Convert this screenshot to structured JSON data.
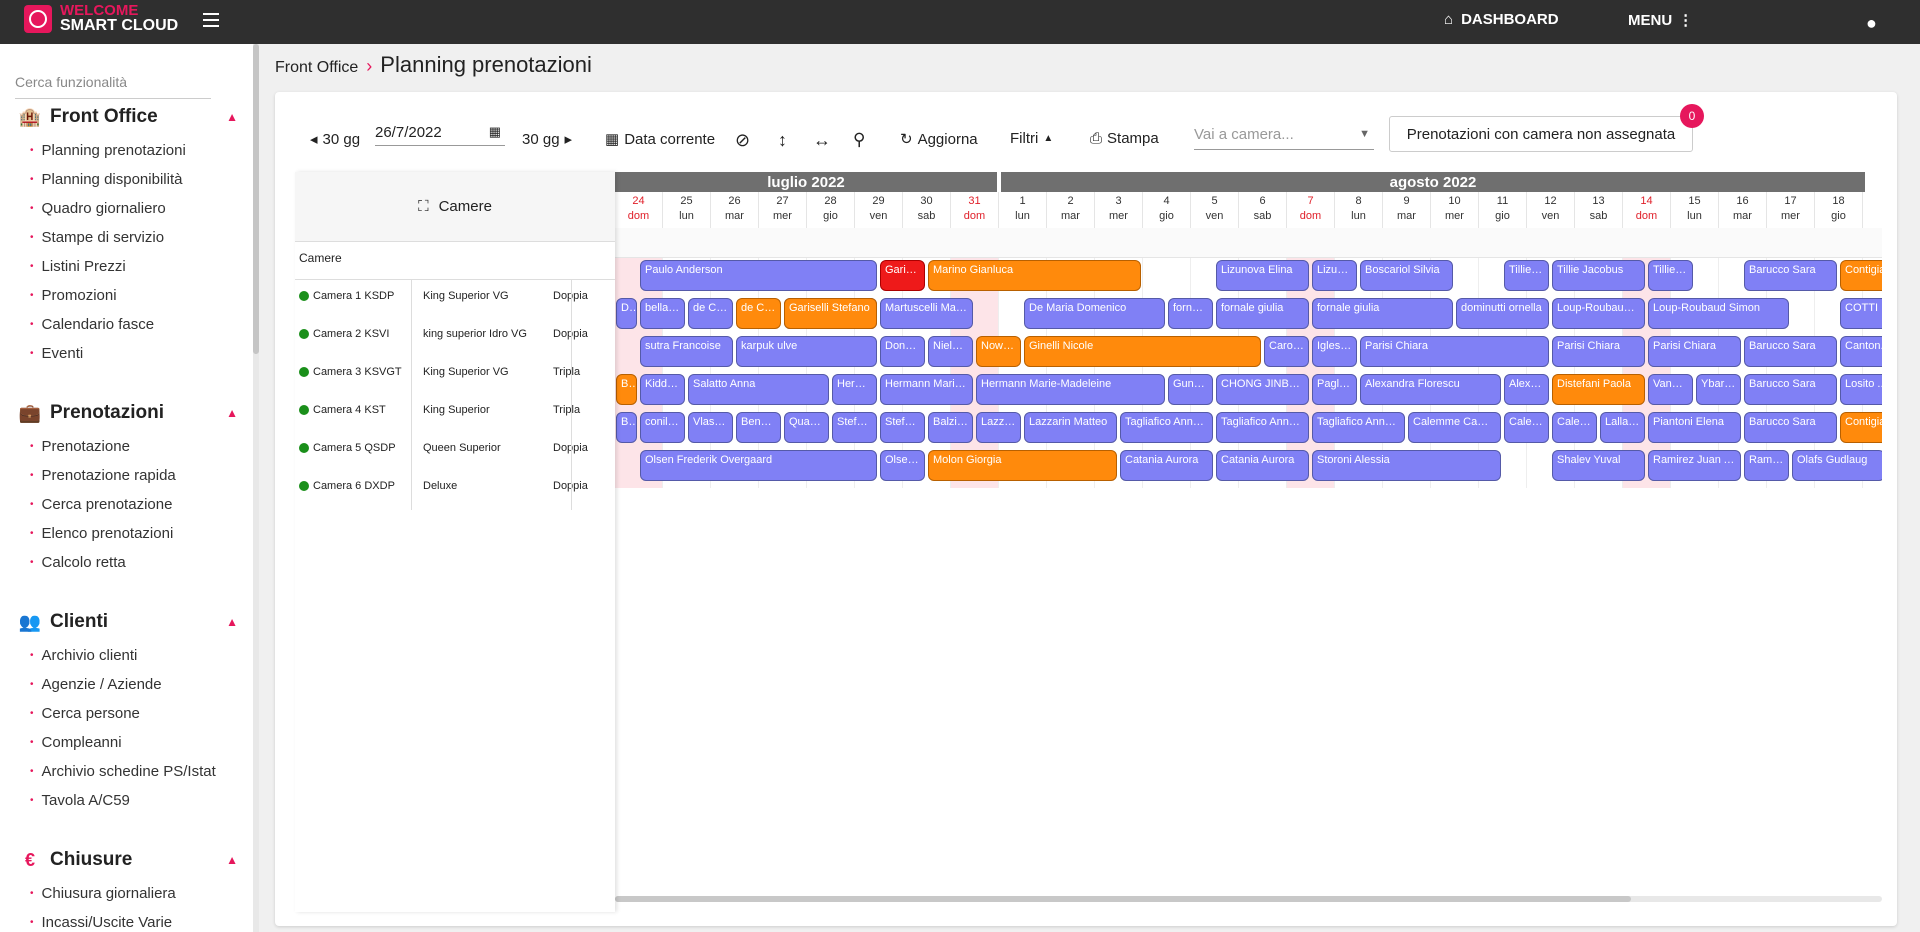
{
  "topbar": {
    "logo_line1": "WELCOME",
    "logo_line2": "SMART CLOUD",
    "dashboard_label": "DASHBOARD",
    "menu_label": "MENU"
  },
  "sidebar": {
    "search_placeholder": "Cerca funzionalità",
    "sections": [
      {
        "title": "Front Office",
        "icon": "hotel-icon",
        "items": [
          "Planning prenotazioni",
          "Planning disponibilità",
          "Quadro giornaliero",
          "Stampe di servizio",
          "Listini Prezzi",
          "Promozioni",
          "Calendario fasce",
          "Eventi"
        ]
      },
      {
        "title": "Prenotazioni",
        "icon": "suitcase-icon",
        "items": [
          "Prenotazione",
          "Prenotazione rapida",
          "Cerca prenotazione",
          "Elenco prenotazioni",
          "Calcolo retta"
        ]
      },
      {
        "title": "Clienti",
        "icon": "users-icon",
        "items": [
          "Archivio clienti",
          "Agenzie / Aziende",
          "Cerca persone",
          "Compleanni",
          "Archivio schedine PS/Istat",
          "Tavola A/C59"
        ]
      },
      {
        "title": "Chiusure",
        "icon": "euro-icon",
        "items": [
          "Chiusura giornaliera",
          "Incassi/Uscite Varie"
        ]
      }
    ]
  },
  "breadcrumb": {
    "parent": "Front Office",
    "current": "Planning prenotazioni"
  },
  "toolbar": {
    "prev_label": "30 gg",
    "date_value": "26/7/2022",
    "next_label": "30 gg",
    "current_date_label": "Data corrente",
    "refresh_label": "Aggiorna",
    "filters_label": "Filtri",
    "print_label": "Stampa",
    "room_select_placeholder": "Vai a camera...",
    "unassigned_label": "Prenotazioni con camera non assegnata",
    "unassigned_count": "0"
  },
  "planning": {
    "rooms_header": "Camere",
    "rooms_subheader": "Camere",
    "months": [
      "luglio 2022",
      "agosto 2022"
    ],
    "days": [
      {
        "n": "24",
        "w": "dom",
        "sun": true
      },
      {
        "n": "25",
        "w": "lun"
      },
      {
        "n": "26",
        "w": "mar"
      },
      {
        "n": "27",
        "w": "mer"
      },
      {
        "n": "28",
        "w": "gio"
      },
      {
        "n": "29",
        "w": "ven"
      },
      {
        "n": "30",
        "w": "sab"
      },
      {
        "n": "31",
        "w": "dom",
        "sun": true
      },
      {
        "n": "1",
        "w": "lun"
      },
      {
        "n": "2",
        "w": "mar"
      },
      {
        "n": "3",
        "w": "mer"
      },
      {
        "n": "4",
        "w": "gio"
      },
      {
        "n": "5",
        "w": "ven"
      },
      {
        "n": "6",
        "w": "sab"
      },
      {
        "n": "7",
        "w": "dom",
        "sun": true
      },
      {
        "n": "8",
        "w": "lun"
      },
      {
        "n": "9",
        "w": "mar"
      },
      {
        "n": "10",
        "w": "mer"
      },
      {
        "n": "11",
        "w": "gio"
      },
      {
        "n": "12",
        "w": "ven"
      },
      {
        "n": "13",
        "w": "sab"
      },
      {
        "n": "14",
        "w": "dom",
        "sun": true
      },
      {
        "n": "15",
        "w": "lun"
      },
      {
        "n": "16",
        "w": "mar"
      },
      {
        "n": "17",
        "w": "mer"
      },
      {
        "n": "18",
        "w": "gio"
      }
    ],
    "rooms": [
      {
        "name": "Camera 1 KSDP",
        "type": "King Superior VG",
        "capacity": "Doppia"
      },
      {
        "name": "Camera 2 KSVI",
        "type": "king superior Idro VG",
        "capacity": "Doppia"
      },
      {
        "name": "Camera 3 KSVGT",
        "type": "King Superior VG",
        "capacity": "Tripla"
      },
      {
        "name": "Camera 4 KST",
        "type": "King Superior",
        "capacity": "Tripla"
      },
      {
        "name": "Camera 5 QSDP",
        "type": "Queen Superior",
        "capacity": "Doppia"
      },
      {
        "name": "Camera 6 DXDP",
        "type": "Deluxe",
        "capacity": "Doppia"
      }
    ],
    "reservations": [
      {
        "row": 0,
        "start": 0.5,
        "end": 5.5,
        "color": "blue",
        "label": "Paulo Anderson"
      },
      {
        "row": 0,
        "start": 5.5,
        "end": 6.5,
        "color": "red",
        "label": "Garisel..."
      },
      {
        "row": 0,
        "start": 6.5,
        "end": 11,
        "color": "orange",
        "label": "Marino Gianluca"
      },
      {
        "row": 0,
        "start": 12.5,
        "end": 14.5,
        "color": "blue",
        "label": "Lizunova Elina"
      },
      {
        "row": 0,
        "start": 14.5,
        "end": 15.5,
        "color": "blue",
        "label": "Lizuno..."
      },
      {
        "row": 0,
        "start": 15.5,
        "end": 17.5,
        "color": "blue",
        "label": "Boscariol Silvia"
      },
      {
        "row": 0,
        "start": 18.5,
        "end": 19.5,
        "color": "blue",
        "label": "Tillie Ja..."
      },
      {
        "row": 0,
        "start": 19.5,
        "end": 21.5,
        "color": "blue",
        "label": "Tillie Jacobus"
      },
      {
        "row": 0,
        "start": 21.5,
        "end": 22.5,
        "color": "blue",
        "label": "Tillie Ja..."
      },
      {
        "row": 0,
        "start": 23.5,
        "end": 25.5,
        "color": "blue",
        "label": "Barucco Sara"
      },
      {
        "row": 0,
        "start": 25.5,
        "end": 27,
        "color": "orange",
        "label": "Contigiani..."
      },
      {
        "row": 1,
        "start": 0,
        "end": 0.5,
        "color": "blue",
        "label": "D..."
      },
      {
        "row": 1,
        "start": 0.5,
        "end": 1.5,
        "color": "blue",
        "label": "bellan..."
      },
      {
        "row": 1,
        "start": 1.5,
        "end": 2.5,
        "color": "blue",
        "label": "de Ces..."
      },
      {
        "row": 1,
        "start": 2.5,
        "end": 3.5,
        "color": "orange",
        "label": "de Ces..."
      },
      {
        "row": 1,
        "start": 3.5,
        "end": 5.5,
        "color": "blue",
        "label": ""
      },
      {
        "row": 1,
        "start": 3.5,
        "end": 5.5,
        "color": "orange",
        "label": "Gariselli Stefano"
      },
      {
        "row": 1,
        "start": 5.5,
        "end": 7.5,
        "color": "blue",
        "label": "Martuscelli Marti..."
      },
      {
        "row": 1,
        "start": 8.5,
        "end": 11.5,
        "color": "blue",
        "label": "De Maria Domenico"
      },
      {
        "row": 1,
        "start": 11.5,
        "end": 12.5,
        "color": "blue",
        "label": "fornale..."
      },
      {
        "row": 1,
        "start": 12.5,
        "end": 14.5,
        "color": "blue",
        "label": "fornale giulia"
      },
      {
        "row": 1,
        "start": 14.5,
        "end": 17.5,
        "color": "blue",
        "label": "fornale giulia"
      },
      {
        "row": 1,
        "start": 17.5,
        "end": 19.5,
        "color": "blue",
        "label": "dominutti ornella"
      },
      {
        "row": 1,
        "start": 19.5,
        "end": 21.5,
        "color": "blue",
        "label": "Loup-Roubaud S..."
      },
      {
        "row": 1,
        "start": 21.5,
        "end": 24.5,
        "color": "blue",
        "label": "Loup-Roubaud Simon"
      },
      {
        "row": 1,
        "start": 25.5,
        "end": 27,
        "color": "blue",
        "label": "COTTI ..."
      },
      {
        "row": 2,
        "start": 0.5,
        "end": 2.5,
        "color": "blue",
        "label": "sutra Francoise"
      },
      {
        "row": 2,
        "start": 2.5,
        "end": 5.5,
        "color": "blue",
        "label": "karpuk ulve"
      },
      {
        "row": 2,
        "start": 5.5,
        "end": 6.5,
        "color": "blue",
        "label": "Donnel..."
      },
      {
        "row": 2,
        "start": 6.5,
        "end": 7.5,
        "color": "blue",
        "label": "Nielse..."
      },
      {
        "row": 2,
        "start": 7.5,
        "end": 8.5,
        "color": "orange",
        "label": "Nowza..."
      },
      {
        "row": 2,
        "start": 8.5,
        "end": 13.5,
        "color": "orange",
        "label": "Ginelli Nicole"
      },
      {
        "row": 2,
        "start": 13.5,
        "end": 14.5,
        "color": "blue",
        "label": "Carozzi..."
      },
      {
        "row": 2,
        "start": 14.5,
        "end": 15.5,
        "color": "blue",
        "label": "Iglesia..."
      },
      {
        "row": 2,
        "start": 15.5,
        "end": 19.5,
        "color": "blue",
        "label": "Parisi Chiara"
      },
      {
        "row": 2,
        "start": 19.5,
        "end": 21.5,
        "color": "blue",
        "label": "Parisi Chiara"
      },
      {
        "row": 2,
        "start": 21.5,
        "end": 23.5,
        "color": "blue",
        "label": "Parisi Chiara"
      },
      {
        "row": 2,
        "start": 23.5,
        "end": 25.5,
        "color": "blue",
        "label": "Barucco Sara"
      },
      {
        "row": 2,
        "start": 25.5,
        "end": 27,
        "color": "blue",
        "label": "Canton..."
      },
      {
        "row": 3,
        "start": 0,
        "end": 0.5,
        "color": "orange",
        "label": "B..."
      },
      {
        "row": 3,
        "start": 0.5,
        "end": 1.5,
        "color": "blue",
        "label": "Kidder ..."
      },
      {
        "row": 3,
        "start": 1.5,
        "end": 4.5,
        "color": "blue",
        "label": "Salatto Anna"
      },
      {
        "row": 3,
        "start": 4.5,
        "end": 5.5,
        "color": "blue",
        "label": "Herma..."
      },
      {
        "row": 3,
        "start": 5.5,
        "end": 7.5,
        "color": "blue",
        "label": "Hermann Marie-..."
      },
      {
        "row": 3,
        "start": 7.5,
        "end": 11.5,
        "color": "blue",
        "label": "Hermann Marie-Madeleine"
      },
      {
        "row": 3,
        "start": 11.5,
        "end": 12.5,
        "color": "blue",
        "label": "Gundo..."
      },
      {
        "row": 3,
        "start": 12.5,
        "end": 14.5,
        "color": "blue",
        "label": "CHONG JINBOM"
      },
      {
        "row": 3,
        "start": 14.5,
        "end": 15.5,
        "color": "blue",
        "label": "Pagliar..."
      },
      {
        "row": 3,
        "start": 15.5,
        "end": 18.5,
        "color": "blue",
        "label": "Alexandra Florescu"
      },
      {
        "row": 3,
        "start": 18.5,
        "end": 19.5,
        "color": "blue",
        "label": "Alexan..."
      },
      {
        "row": 3,
        "start": 19.5,
        "end": 21.5,
        "color": "orange",
        "label": "Distefani Paola"
      },
      {
        "row": 3,
        "start": 21.5,
        "end": 22.5,
        "color": "blue",
        "label": "Vannu..."
      },
      {
        "row": 3,
        "start": 22.5,
        "end": 23.5,
        "color": "blue",
        "label": "Ybarra ..."
      },
      {
        "row": 3,
        "start": 23.5,
        "end": 25.5,
        "color": "blue",
        "label": "Barucco Sara"
      },
      {
        "row": 3,
        "start": 25.5,
        "end": 27,
        "color": "blue",
        "label": "Losito ..."
      },
      {
        "row": 4,
        "start": 0,
        "end": 0.5,
        "color": "blue",
        "label": "B..."
      },
      {
        "row": 4,
        "start": 0.5,
        "end": 1.5,
        "color": "blue",
        "label": "conil W..."
      },
      {
        "row": 4,
        "start": 1.5,
        "end": 2.5,
        "color": "blue",
        "label": "Vlasak..."
      },
      {
        "row": 4,
        "start": 2.5,
        "end": 3.5,
        "color": "blue",
        "label": "Benha..."
      },
      {
        "row": 4,
        "start": 3.5,
        "end": 4.5,
        "color": "blue",
        "label": "Quant ..."
      },
      {
        "row": 4,
        "start": 4.5,
        "end": 5.5,
        "color": "blue",
        "label": "Stefani..."
      },
      {
        "row": 4,
        "start": 5.5,
        "end": 6.5,
        "color": "blue",
        "label": "Stefani..."
      },
      {
        "row": 4,
        "start": 6.5,
        "end": 7.5,
        "color": "blue",
        "label": "Balzi J..."
      },
      {
        "row": 4,
        "start": 7.5,
        "end": 8.5,
        "color": "blue",
        "label": "Lazzari..."
      },
      {
        "row": 4,
        "start": 8.5,
        "end": 10.5,
        "color": "blue",
        "label": "Lazzarin Matteo"
      },
      {
        "row": 4,
        "start": 10.5,
        "end": 12.5,
        "color": "blue",
        "label": "Tagliafico Anna ..."
      },
      {
        "row": 4,
        "start": 12.5,
        "end": 14.5,
        "color": "blue",
        "label": "Tagliafico Anna ..."
      },
      {
        "row": 4,
        "start": 14.5,
        "end": 16.5,
        "color": "blue",
        "label": "Tagliafico Anna ..."
      },
      {
        "row": 4,
        "start": 16.5,
        "end": 18.5,
        "color": "blue",
        "label": "Calemme Camilla"
      },
      {
        "row": 4,
        "start": 18.5,
        "end": 19.5,
        "color": "blue",
        "label": "Calem..."
      },
      {
        "row": 4,
        "start": 19.5,
        "end": 20.5,
        "color": "blue",
        "label": "Calem..."
      },
      {
        "row": 4,
        "start": 20.5,
        "end": 21.5,
        "color": "blue",
        "label": "Lalla Gi..."
      },
      {
        "row": 4,
        "start": 21.5,
        "end": 23.5,
        "color": "blue",
        "label": "Piantoni Elena"
      },
      {
        "row": 4,
        "start": 23.5,
        "end": 25.5,
        "color": "blue",
        "label": "Barucco Sara"
      },
      {
        "row": 4,
        "start": 25.5,
        "end": 27,
        "color": "orange",
        "label": "Contigiani..."
      },
      {
        "row": 5,
        "start": 0.5,
        "end": 5.5,
        "color": "blue",
        "label": "Olsen Frederik Overgaard"
      },
      {
        "row": 5,
        "start": 5.5,
        "end": 6.5,
        "color": "blue",
        "label": "Olsen ..."
      },
      {
        "row": 5,
        "start": 6.5,
        "end": 10.5,
        "color": "orange",
        "label": "Molon Giorgia"
      },
      {
        "row": 5,
        "start": 10.5,
        "end": 12.5,
        "color": "blue",
        "label": "Catania Aurora"
      },
      {
        "row": 5,
        "start": 12.5,
        "end": 14.5,
        "color": "blue",
        "label": "Catania Aurora"
      },
      {
        "row": 5,
        "start": 14.5,
        "end": 18.5,
        "color": "blue",
        "label": "Storoni Alessia"
      },
      {
        "row": 5,
        "start": 19.5,
        "end": 21.5,
        "color": "blue",
        "label": "Shalev Yuval"
      },
      {
        "row": 5,
        "start": 21.5,
        "end": 23.5,
        "color": "blue",
        "label": "Ramirez Juan An..."
      },
      {
        "row": 5,
        "start": 23.5,
        "end": 24.5,
        "color": "blue",
        "label": "Ramire..."
      },
      {
        "row": 5,
        "start": 24.5,
        "end": 26.5,
        "color": "blue",
        "label": "Olafs Gudlaug"
      }
    ]
  }
}
